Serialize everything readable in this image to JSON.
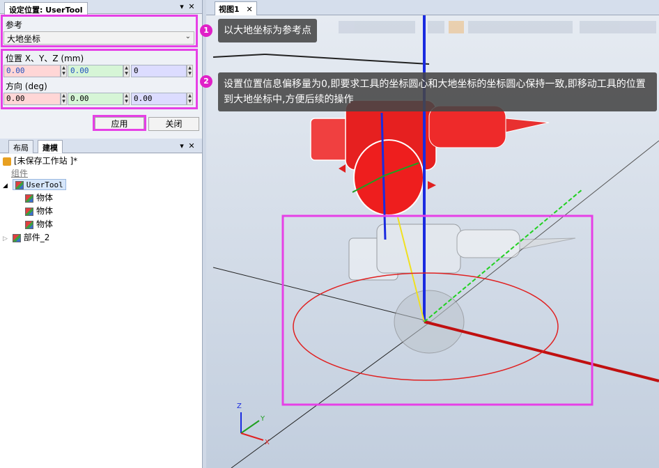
{
  "set_position_panel": {
    "tab_label": "设定位置: UserTool",
    "reference_label": "参考",
    "reference_value": "大地坐标",
    "position_label": "位置 X、Y、Z (mm)",
    "position_values": [
      "0.00",
      "0.00",
      "0"
    ],
    "orientation_label": "方向 (deg)",
    "orientation_values": [
      "0.00",
      "0.00",
      "0.00"
    ],
    "apply_label": "应用",
    "close_label": "关闭"
  },
  "tree_panel": {
    "tabs": [
      "布局",
      "建模"
    ],
    "station_label": "[未保存工作站 ]*",
    "group_label": "组件",
    "items": [
      {
        "label": "UserTool",
        "level": 1
      },
      {
        "label": "物体",
        "level": 2
      },
      {
        "label": "物体",
        "level": 2
      },
      {
        "label": "物体",
        "level": 2
      },
      {
        "label": "部件_2",
        "level": 1
      }
    ]
  },
  "view": {
    "tab_label": "视图1",
    "axis_labels": {
      "x": "X",
      "y": "Y",
      "z": "Z"
    }
  },
  "callouts": [
    {
      "number": "1",
      "text": "以大地坐标为参考点"
    },
    {
      "number": "2",
      "text": "设置位置信息偏移量为0,即要求工具的坐标圆心和大地坐标的坐标圆心保持一致,即移动工具的位置到大地坐标中,方便后续的操作"
    }
  ],
  "colors": {
    "highlight": "#e640e6",
    "badge": "#e020c8",
    "x_axis": "#e02020",
    "y_axis": "#20c020",
    "z_axis": "#1a2be0"
  }
}
